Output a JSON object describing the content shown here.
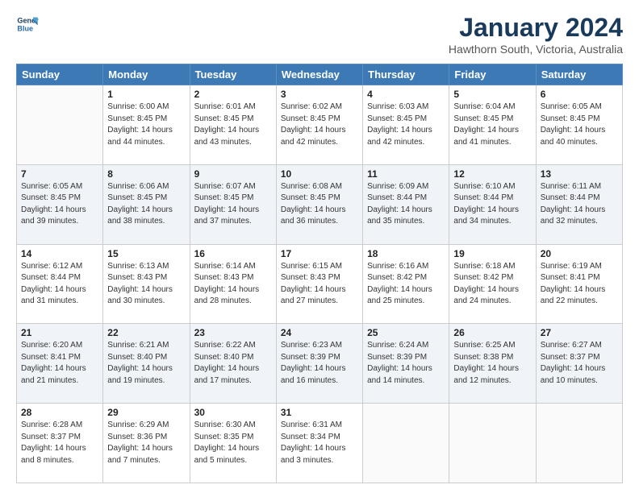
{
  "logo": {
    "line1": "General",
    "line2": "Blue"
  },
  "title": "January 2024",
  "subtitle": "Hawthorn South, Victoria, Australia",
  "days_of_week": [
    "Sunday",
    "Monday",
    "Tuesday",
    "Wednesday",
    "Thursday",
    "Friday",
    "Saturday"
  ],
  "weeks": [
    [
      {
        "day": "",
        "info": ""
      },
      {
        "day": "1",
        "info": "Sunrise: 6:00 AM\nSunset: 8:45 PM\nDaylight: 14 hours\nand 44 minutes."
      },
      {
        "day": "2",
        "info": "Sunrise: 6:01 AM\nSunset: 8:45 PM\nDaylight: 14 hours\nand 43 minutes."
      },
      {
        "day": "3",
        "info": "Sunrise: 6:02 AM\nSunset: 8:45 PM\nDaylight: 14 hours\nand 42 minutes."
      },
      {
        "day": "4",
        "info": "Sunrise: 6:03 AM\nSunset: 8:45 PM\nDaylight: 14 hours\nand 42 minutes."
      },
      {
        "day": "5",
        "info": "Sunrise: 6:04 AM\nSunset: 8:45 PM\nDaylight: 14 hours\nand 41 minutes."
      },
      {
        "day": "6",
        "info": "Sunrise: 6:05 AM\nSunset: 8:45 PM\nDaylight: 14 hours\nand 40 minutes."
      }
    ],
    [
      {
        "day": "7",
        "info": "Sunrise: 6:05 AM\nSunset: 8:45 PM\nDaylight: 14 hours\nand 39 minutes."
      },
      {
        "day": "8",
        "info": "Sunrise: 6:06 AM\nSunset: 8:45 PM\nDaylight: 14 hours\nand 38 minutes."
      },
      {
        "day": "9",
        "info": "Sunrise: 6:07 AM\nSunset: 8:45 PM\nDaylight: 14 hours\nand 37 minutes."
      },
      {
        "day": "10",
        "info": "Sunrise: 6:08 AM\nSunset: 8:45 PM\nDaylight: 14 hours\nand 36 minutes."
      },
      {
        "day": "11",
        "info": "Sunrise: 6:09 AM\nSunset: 8:44 PM\nDaylight: 14 hours\nand 35 minutes."
      },
      {
        "day": "12",
        "info": "Sunrise: 6:10 AM\nSunset: 8:44 PM\nDaylight: 14 hours\nand 34 minutes."
      },
      {
        "day": "13",
        "info": "Sunrise: 6:11 AM\nSunset: 8:44 PM\nDaylight: 14 hours\nand 32 minutes."
      }
    ],
    [
      {
        "day": "14",
        "info": "Sunrise: 6:12 AM\nSunset: 8:44 PM\nDaylight: 14 hours\nand 31 minutes."
      },
      {
        "day": "15",
        "info": "Sunrise: 6:13 AM\nSunset: 8:43 PM\nDaylight: 14 hours\nand 30 minutes."
      },
      {
        "day": "16",
        "info": "Sunrise: 6:14 AM\nSunset: 8:43 PM\nDaylight: 14 hours\nand 28 minutes."
      },
      {
        "day": "17",
        "info": "Sunrise: 6:15 AM\nSunset: 8:43 PM\nDaylight: 14 hours\nand 27 minutes."
      },
      {
        "day": "18",
        "info": "Sunrise: 6:16 AM\nSunset: 8:42 PM\nDaylight: 14 hours\nand 25 minutes."
      },
      {
        "day": "19",
        "info": "Sunrise: 6:18 AM\nSunset: 8:42 PM\nDaylight: 14 hours\nand 24 minutes."
      },
      {
        "day": "20",
        "info": "Sunrise: 6:19 AM\nSunset: 8:41 PM\nDaylight: 14 hours\nand 22 minutes."
      }
    ],
    [
      {
        "day": "21",
        "info": "Sunrise: 6:20 AM\nSunset: 8:41 PM\nDaylight: 14 hours\nand 21 minutes."
      },
      {
        "day": "22",
        "info": "Sunrise: 6:21 AM\nSunset: 8:40 PM\nDaylight: 14 hours\nand 19 minutes."
      },
      {
        "day": "23",
        "info": "Sunrise: 6:22 AM\nSunset: 8:40 PM\nDaylight: 14 hours\nand 17 minutes."
      },
      {
        "day": "24",
        "info": "Sunrise: 6:23 AM\nSunset: 8:39 PM\nDaylight: 14 hours\nand 16 minutes."
      },
      {
        "day": "25",
        "info": "Sunrise: 6:24 AM\nSunset: 8:39 PM\nDaylight: 14 hours\nand 14 minutes."
      },
      {
        "day": "26",
        "info": "Sunrise: 6:25 AM\nSunset: 8:38 PM\nDaylight: 14 hours\nand 12 minutes."
      },
      {
        "day": "27",
        "info": "Sunrise: 6:27 AM\nSunset: 8:37 PM\nDaylight: 14 hours\nand 10 minutes."
      }
    ],
    [
      {
        "day": "28",
        "info": "Sunrise: 6:28 AM\nSunset: 8:37 PM\nDaylight: 14 hours\nand 8 minutes."
      },
      {
        "day": "29",
        "info": "Sunrise: 6:29 AM\nSunset: 8:36 PM\nDaylight: 14 hours\nand 7 minutes."
      },
      {
        "day": "30",
        "info": "Sunrise: 6:30 AM\nSunset: 8:35 PM\nDaylight: 14 hours\nand 5 minutes."
      },
      {
        "day": "31",
        "info": "Sunrise: 6:31 AM\nSunset: 8:34 PM\nDaylight: 14 hours\nand 3 minutes."
      },
      {
        "day": "",
        "info": ""
      },
      {
        "day": "",
        "info": ""
      },
      {
        "day": "",
        "info": ""
      }
    ]
  ]
}
